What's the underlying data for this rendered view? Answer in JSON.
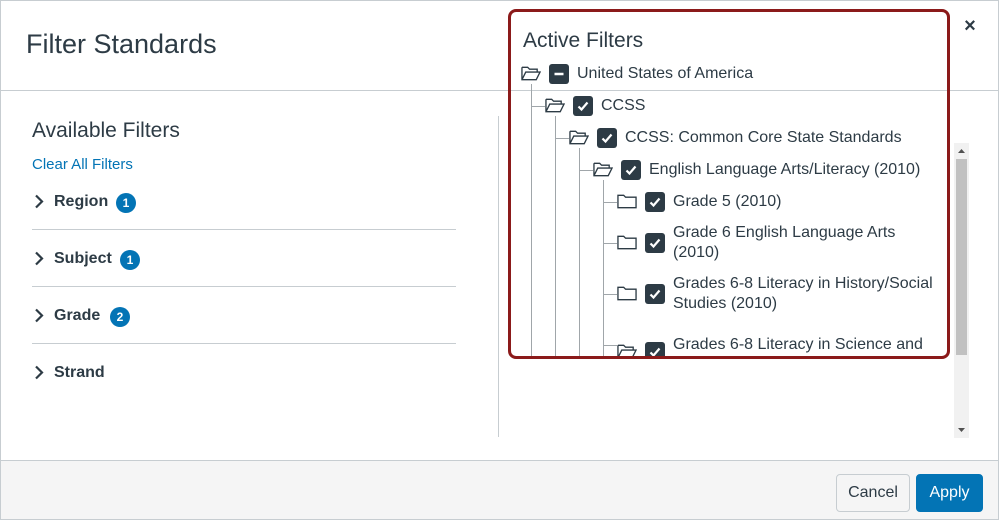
{
  "dialog": {
    "title": "Filter Standards",
    "close_label": "×"
  },
  "available": {
    "title": "Available Filters",
    "clear_label": "Clear All Filters",
    "filters": [
      {
        "label": "Region",
        "count": "1"
      },
      {
        "label": "Subject",
        "count": "1"
      },
      {
        "label": "Grade",
        "count": "2"
      },
      {
        "label": "Strand",
        "count": ""
      }
    ]
  },
  "active": {
    "title": "Active Filters",
    "tree": [
      {
        "label": "United States of America",
        "state": "partial",
        "folder": "open"
      },
      {
        "label": "CCSS",
        "state": "checked",
        "folder": "open"
      },
      {
        "label": "CCSS: Common Core State Standards",
        "state": "checked",
        "folder": "open"
      },
      {
        "label": "English Language Arts/Literacy (2010)",
        "state": "checked",
        "folder": "open"
      },
      {
        "label": "Grade 5 (2010)",
        "state": "checked",
        "folder": "closed"
      },
      {
        "label_line1": "Grade 6 English Language Arts",
        "label_line2": "(2010)",
        "state": "checked",
        "folder": "closed"
      },
      {
        "label_line1": "Grades 6-8 Literacy in History/Social",
        "label_line2": "Studies (2010)",
        "state": "checked",
        "folder": "closed"
      },
      {
        "label_line1": "Grades 6-8 Literacy in Science and",
        "state": "checked",
        "folder": "open"
      }
    ]
  },
  "footer": {
    "cancel_label": "Cancel",
    "apply_label": "Apply"
  },
  "colors": {
    "accent": "#0374b5",
    "highlight_border": "#8b1a1a",
    "text": "#2d3b45"
  }
}
